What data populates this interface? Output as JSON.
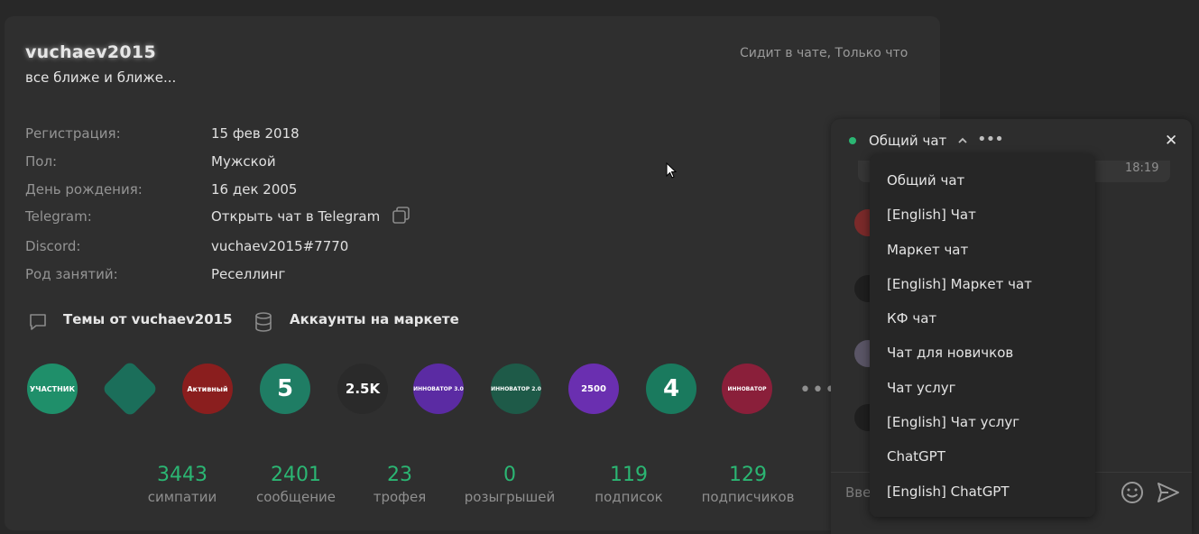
{
  "profile": {
    "username": "vuchaev2015",
    "status": "все ближе и ближе...",
    "last_seen": "Сидит в чате, Только что",
    "info": [
      {
        "label": "Регистрация:",
        "value": "15 фев 2018"
      },
      {
        "label": "Пол:",
        "value": "Мужской"
      },
      {
        "label": "День рождения:",
        "value": "16 дек 2005"
      },
      {
        "label": "Telegram:",
        "value": "Открыть чат в Telegram"
      },
      {
        "label": "Discord:",
        "value": "vuchaev2015#7770"
      },
      {
        "label": "Род занятий:",
        "value": "Реселлинг"
      }
    ],
    "links": {
      "threads": "Темы от vuchaev2015",
      "market": "Аккаунты на маркете"
    },
    "trophies": [
      {
        "name": "УЧАСТНИК",
        "color": "#1f8f6a"
      },
      {
        "name": "",
        "color": "#1b6e5a"
      },
      {
        "name": "Активный",
        "color": "#8a1e1e"
      },
      {
        "name": "5",
        "color": "#1f7d64"
      },
      {
        "name": "2.5K",
        "color": "#2a2a2a"
      },
      {
        "name": "ИННОВАТОР 3.0",
        "color": "#5b2ba3"
      },
      {
        "name": "ИННОВАТОР 2.0",
        "color": "#1e5a48"
      },
      {
        "name": "2500",
        "color": "#6a2fb0"
      },
      {
        "name": "4",
        "color": "#1a7a5e"
      },
      {
        "name": "ИННОВАТОР",
        "color": "#8a1f3a"
      }
    ],
    "more": "•••",
    "stats": [
      {
        "value": "3443",
        "label": "симпатии"
      },
      {
        "value": "2401",
        "label": "сообщение"
      },
      {
        "value": "23",
        "label": "трофея"
      },
      {
        "value": "0",
        "label": "розыгрышей"
      },
      {
        "value": "119",
        "label": "подписок"
      },
      {
        "value": "129",
        "label": "подписчиков"
      }
    ]
  },
  "chat": {
    "title": "Общий чат",
    "menu_dots": "•••",
    "close": "✕",
    "time": "18:19",
    "input_placeholder": "Вве",
    "rooms": [
      "Общий чат",
      "[English] Чат",
      "Маркет чат",
      "[English] Маркет чат",
      "КФ чат",
      "Чат для новичков",
      "Чат услуг",
      "[English] Чат услуг",
      "ChatGPT",
      "[English] ChatGPT"
    ]
  },
  "colors": {
    "accent": "#2bb673",
    "background": "#282828",
    "panel": "#2f2f2f"
  }
}
